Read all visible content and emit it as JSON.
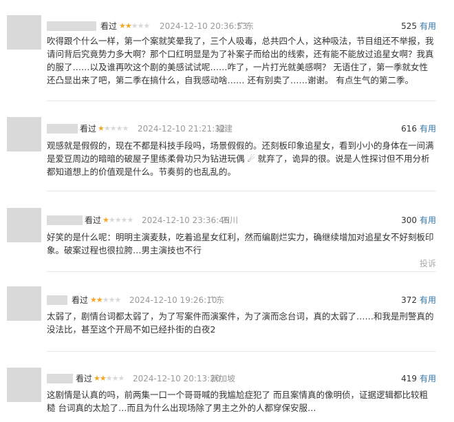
{
  "useful_label": "有用",
  "report_label": "投诉",
  "colors": {
    "accent": "#3377aa",
    "star": "#f5a623",
    "meta": "#9a9a9a"
  },
  "comments": [
    {
      "status": "看过",
      "rating": 2,
      "datetime": "2024-12-10 20:36:53",
      "location": "广东",
      "useful_count": "525",
      "text": "吹得跟个什么一样，第一个案就笑晕我了，三个人吸毒，总共四个人，这种吸法，节目组还不举报，我请问背后究竟势力多大啊？那个口红明显是为了补案子而给出的线索，还有能不能放过追星女啊？我真的服了……以及谁再吹这个剧的美感试试呢……咋了，一片打光就美感啊？ 无语住了，第一季就女性还凸显出来了吧，第二季在搞什么，自我感动啥…… 还有别卖了……谢谢。 有点生气的第二季。"
    },
    {
      "status": "看过",
      "rating": 1,
      "datetime": "2024-12-10 21:21:32",
      "location": "福建",
      "useful_count": "616",
      "text": "观感就是假假的，现在不都是科技手段吗，场景假假的。还刻板印象追星女，看到小小的身体在一间满是爱豆周边的暗暗的破屋子里练柔骨功只为钻进玩偶 ☄ 就弃了，诡异的很。说是人性探讨但不用分析都知道想上的价值观是什么。节奏剪的也乱乱的。"
    },
    {
      "status": "看过",
      "rating": 1,
      "datetime": "2024-12-10 23:36:46",
      "location": "四川",
      "useful_count": "300",
      "text": "好笑的是什么呢：明明主演麦麸，吃着追星女红利，然而编剧烂实力，确继续增加对追星女不好刻板印象。破案过程也很拉胯…男主演技也不行",
      "show_report": true
    },
    {
      "status": "看过",
      "rating": 2,
      "datetime": "2024-12-10 19:26:10",
      "location": "广东",
      "useful_count": "372",
      "text": "太弱了，剧情台词都太弱了，为了写案件而演案件，为了演而念台词，真的太弱了……和我是刑警真的没法比，甚至这个开局不如已经扑街的白夜2"
    },
    {
      "status": "看过",
      "rating": 2,
      "datetime": "2024-12-10 20:13:20",
      "location": "新加坡",
      "useful_count": "419",
      "text": "这剧情是认真的吗，前两集一口一个哥哥喊的我尴尬症犯了 而且案情真的像明侦，证据逻辑都比较粗糙 台词真的太尬了…而且为什么出现场除了男主之外的人都穿保安服…"
    }
  ]
}
